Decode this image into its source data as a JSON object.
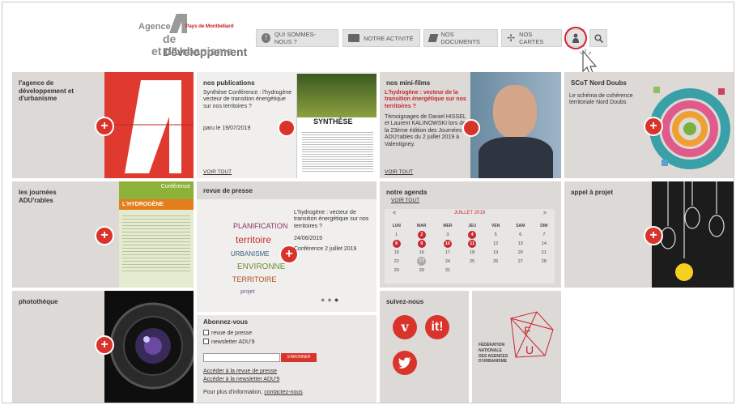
{
  "logo": {
    "line1": "Agence",
    "line2": "Pays de Montbéliard",
    "line3a": "de ",
    "line3b": "Développement",
    "line4": "et d'Urbanisme"
  },
  "nav": {
    "qui": "QUI SOMMES-NOUS ?",
    "activite": "NOTRE ACTIVITÉ",
    "documents": "NOS DOCUMENTS",
    "cartes": "NOS CARTES"
  },
  "tiles": {
    "agence": {
      "title": "l'agence de développement et d'urbanisme"
    },
    "publications": {
      "title": "nos publications",
      "subtitle": "Synthèse Conférence : l'hydrogène vecteur de transition énergétique sur nos territoires ?",
      "date": "paru le 19/07/2019",
      "voir": "VOIR TOUT",
      "img_label": "SYNTHÈSE"
    },
    "films": {
      "title": "nos mini-films",
      "red": "L'hydrogène : vecteur de la transition énergétique sur nos territoires ?",
      "desc": "Témoignages de Daniel HISSEL et Laurent KALINOWSKI lors de la 23ème édition des Journées ADU'rables du 2 juillet 2019 à Valentigney.",
      "voir": "VOIR TOUT"
    },
    "scot": {
      "title": "SCoT Nord Doubs",
      "desc": "Le schéma de cohérence territoriale Nord Doubs"
    },
    "journees": {
      "title": "les journées ADU'rables",
      "img_title": "L'HYDROGÈNE",
      "img_sub": "Conférence"
    },
    "revue": {
      "title": "revue de presse",
      "text": "L'hydrogène : vecteur de transition énergétique sur nos territoires ?",
      "date": "24/06/2019",
      "conf": "Conférence 2 juillet 2019"
    },
    "agenda": {
      "title": "notre agenda",
      "voir": "VOIR TOUT"
    },
    "appel": {
      "title": "appel à projet"
    },
    "phototheque": {
      "title": "photothèque"
    },
    "suivez": {
      "title": "suivez-nous"
    },
    "fnau": {
      "line1": "FÉDÉRATION",
      "line2": "NATIONALE",
      "line3": "DES AGENCES",
      "line4": "D'URBANISME"
    }
  },
  "calendar": {
    "prev": "<",
    "next": ">",
    "month": "JUILLET 2019",
    "days": [
      "LUN",
      "MAR",
      "MER",
      "JEU",
      "VEN",
      "SAM",
      "DIM"
    ],
    "weeks": [
      [
        "1",
        "2",
        "3",
        "4",
        "5",
        "6",
        "7"
      ],
      [
        "8",
        "9",
        "10",
        "11",
        "12",
        "13",
        "14"
      ],
      [
        "15",
        "16",
        "17",
        "18",
        "19",
        "20",
        "21"
      ],
      [
        "22",
        "23",
        "24",
        "25",
        "26",
        "27",
        "28"
      ],
      [
        "29",
        "30",
        "31",
        "",
        "",
        "",
        ""
      ]
    ],
    "highlighted": [
      "2",
      "4",
      "8",
      "9",
      "10",
      "11"
    ],
    "today": "23"
  },
  "abonnez": {
    "title": "Abonnez-vous",
    "opt1": "revue de presse",
    "opt2": "newsletter ADU'9",
    "button": "S'ABONNER",
    "link1": "Accéder à la revue de presse",
    "link2": "Accéder à la newsletter ADU'9",
    "info": "Pour plus d'information,",
    "contact": "contactez-nous"
  },
  "colors": {
    "accent": "#d9342b",
    "tile": "#dcd9d7"
  }
}
